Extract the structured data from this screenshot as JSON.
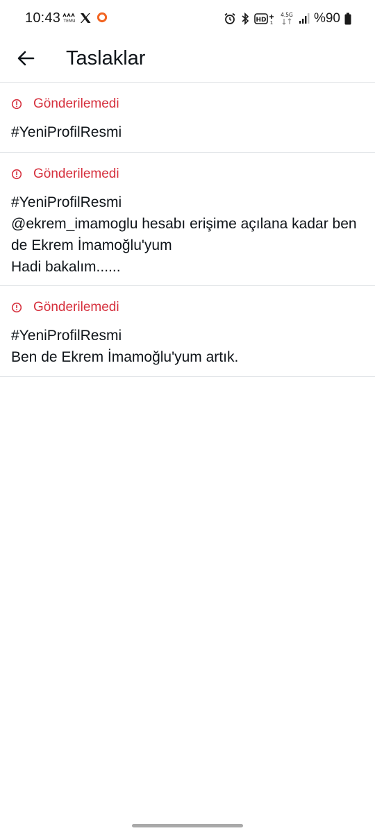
{
  "status_bar": {
    "time": "10:43",
    "temu_icon_text": "TEMU",
    "network_label": "4.5G",
    "battery_text": "%90"
  },
  "header": {
    "title": "Taslaklar",
    "back_icon": "arrow-left-icon"
  },
  "drafts": [
    {
      "status": "Gönderilemedi",
      "text": "#YeniProfilResmi"
    },
    {
      "status": "Gönderilemedi",
      "text": "#YeniProfilResmi\n@ekrem_imamoglu hesabı erişime açılana kadar ben de Ekrem İmamoğlu'yum\nHadi bakalım......"
    },
    {
      "status": "Gönderilemedi",
      "text": "#YeniProfilResmi\nBen de Ekrem İmamoğlu'yum artık."
    }
  ],
  "colors": {
    "error": "#d6303d",
    "text": "#0f1419",
    "divider": "#e2e5e8"
  }
}
